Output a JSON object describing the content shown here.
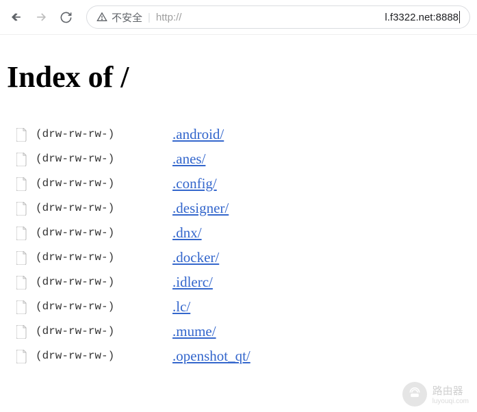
{
  "browser": {
    "insecure_label": "不安全",
    "protocol": "http://",
    "url_display": "l.f3322.net:8888"
  },
  "page": {
    "title": "Index of /"
  },
  "entries": [
    {
      "perm": "(drw-rw-rw-)",
      "name": ".android/"
    },
    {
      "perm": "(drw-rw-rw-)",
      "name": ".anes/"
    },
    {
      "perm": "(drw-rw-rw-)",
      "name": ".config/"
    },
    {
      "perm": "(drw-rw-rw-)",
      "name": ".designer/"
    },
    {
      "perm": "(drw-rw-rw-)",
      "name": ".dnx/"
    },
    {
      "perm": "(drw-rw-rw-)",
      "name": ".docker/"
    },
    {
      "perm": "(drw-rw-rw-)",
      "name": ".idlerc/"
    },
    {
      "perm": "(drw-rw-rw-)",
      "name": ".lc/"
    },
    {
      "perm": "(drw-rw-rw-)",
      "name": ".mume/"
    },
    {
      "perm": "(drw-rw-rw-)",
      "name": ".openshot_qt/"
    }
  ],
  "watermark": {
    "main": "路由器",
    "sub": "luyouqi.com"
  }
}
